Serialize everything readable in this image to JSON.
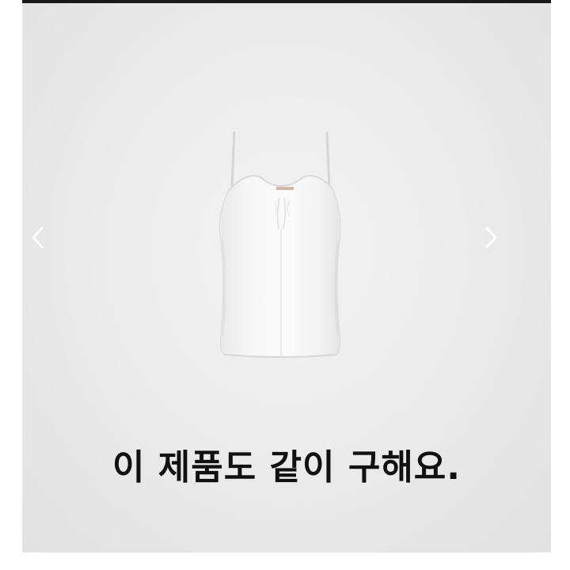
{
  "image": {
    "product_icon": "camisole-top-icon",
    "background_color": "#ebebeb",
    "caption": "이 제품도 같이 구해요."
  },
  "carousel": {
    "prev_icon": "chevron-left-icon",
    "next_icon": "chevron-right-icon"
  }
}
